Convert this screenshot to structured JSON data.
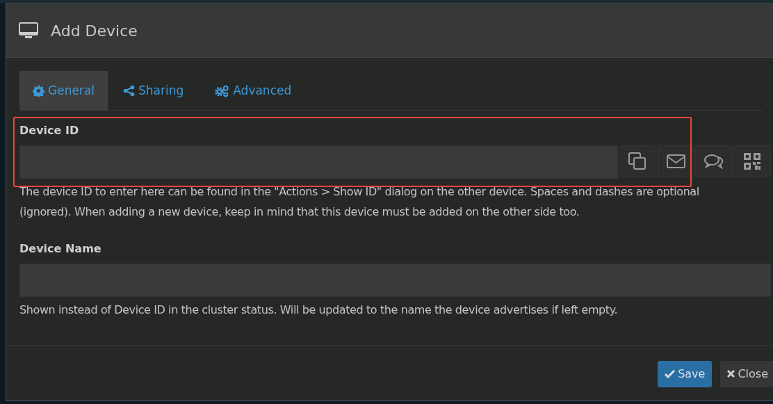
{
  "dialog": {
    "title": "Add Device"
  },
  "tabs": [
    {
      "label": "General",
      "selected": true
    },
    {
      "label": "Sharing",
      "selected": false
    },
    {
      "label": "Advanced",
      "selected": false
    }
  ],
  "fields": [
    {
      "label": "Device ID",
      "highlighted": true,
      "buttons": [
        {
          "kind": "copy"
        },
        {
          "kind": "email"
        },
        {
          "kind": "chat"
        },
        {
          "kind": "qr"
        }
      ],
      "help": "The device ID to enter here can be found in the \"Actions > Show ID\" dialog on the other device. Spaces and dashes are optional (ignored). When adding a new device, keep in mind that this device must be added on the other side too."
    },
    {
      "label": "Device Name",
      "highlighted": false,
      "help": "Shown instead of Device ID in the cluster status. Will be updated to the name the device advertises if left empty."
    }
  ],
  "footer": {
    "buttons": [
      {
        "kind": "primary",
        "label": "Save"
      },
      {
        "kind": "default",
        "label": "Close"
      }
    ]
  }
}
